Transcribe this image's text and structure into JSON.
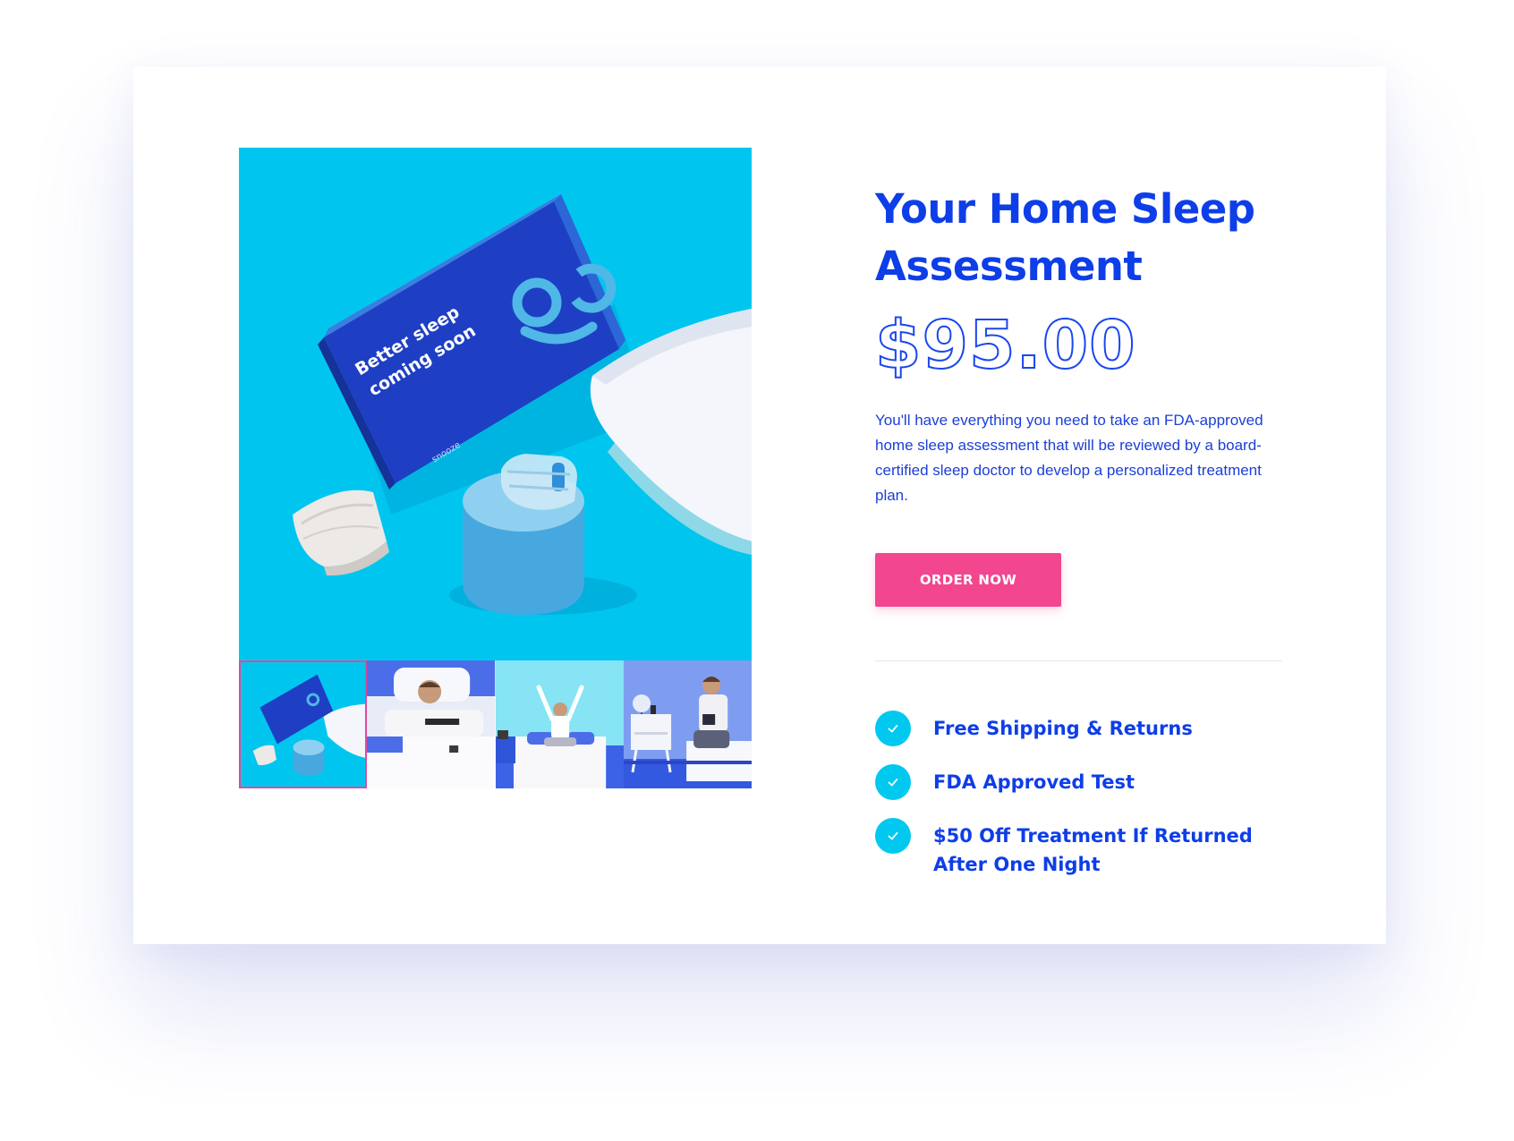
{
  "product": {
    "title": "Your Home Sleep Assessment",
    "price": "$95.00",
    "description": "You'll have everything you need to take an FDA-approved home sleep assessment that will be reviewed by a board-certified sleep doctor to develop a personalized treatment plan.",
    "order_button_label": "ORDER NOW"
  },
  "gallery": {
    "box_text_line1": "Better sleep",
    "box_text_line2": "coming soon",
    "box_brand": "snooze",
    "thumbnails": [
      {
        "name": "kit-box-thumbnail",
        "selected": true
      },
      {
        "name": "man-sleeping-thumbnail",
        "selected": false
      },
      {
        "name": "man-waking-thumbnail",
        "selected": false
      },
      {
        "name": "man-reading-thumbnail",
        "selected": false
      }
    ]
  },
  "features": [
    {
      "label": "Free Shipping & Returns",
      "icon": "check-icon"
    },
    {
      "label": "FDA Approved Test",
      "icon": "check-icon"
    },
    {
      "label": "$50 Off Treatment If Returned After One Night",
      "icon": "check-icon"
    }
  ],
  "colors": {
    "brand_blue": "#0e3ee8",
    "accent_cyan": "#00c8ef",
    "cta_pink": "#f2468f",
    "thumbnail_selected_border": "#e24a9b"
  }
}
